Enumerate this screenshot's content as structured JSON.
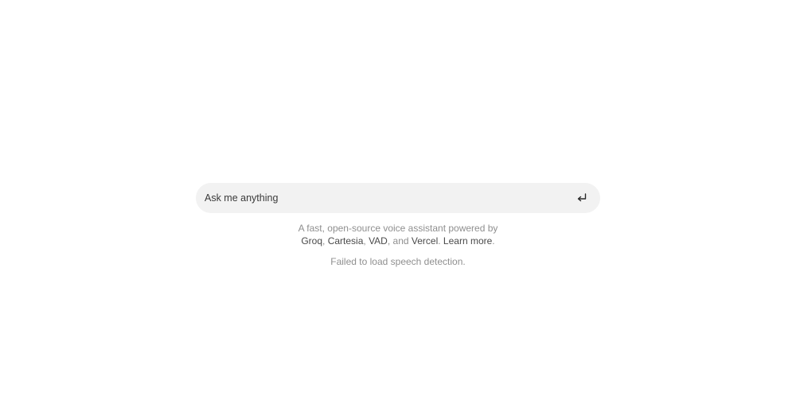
{
  "prompt": {
    "placeholder": "Ask me anything",
    "value": "",
    "submit_icon": "enter-return-icon"
  },
  "footer": {
    "intro": "A fast, open-source voice assistant powered by",
    "links": {
      "groq": "Groq",
      "cartesia": "Cartesia",
      "vad": "VAD",
      "vercel": "Vercel",
      "learn_more": "Learn more"
    },
    "separators": {
      "comma1": ", ",
      "comma2": ", ",
      "and": ", and ",
      "period1": ". ",
      "period2": "."
    }
  },
  "status": {
    "message": "Failed to load speech detection."
  }
}
